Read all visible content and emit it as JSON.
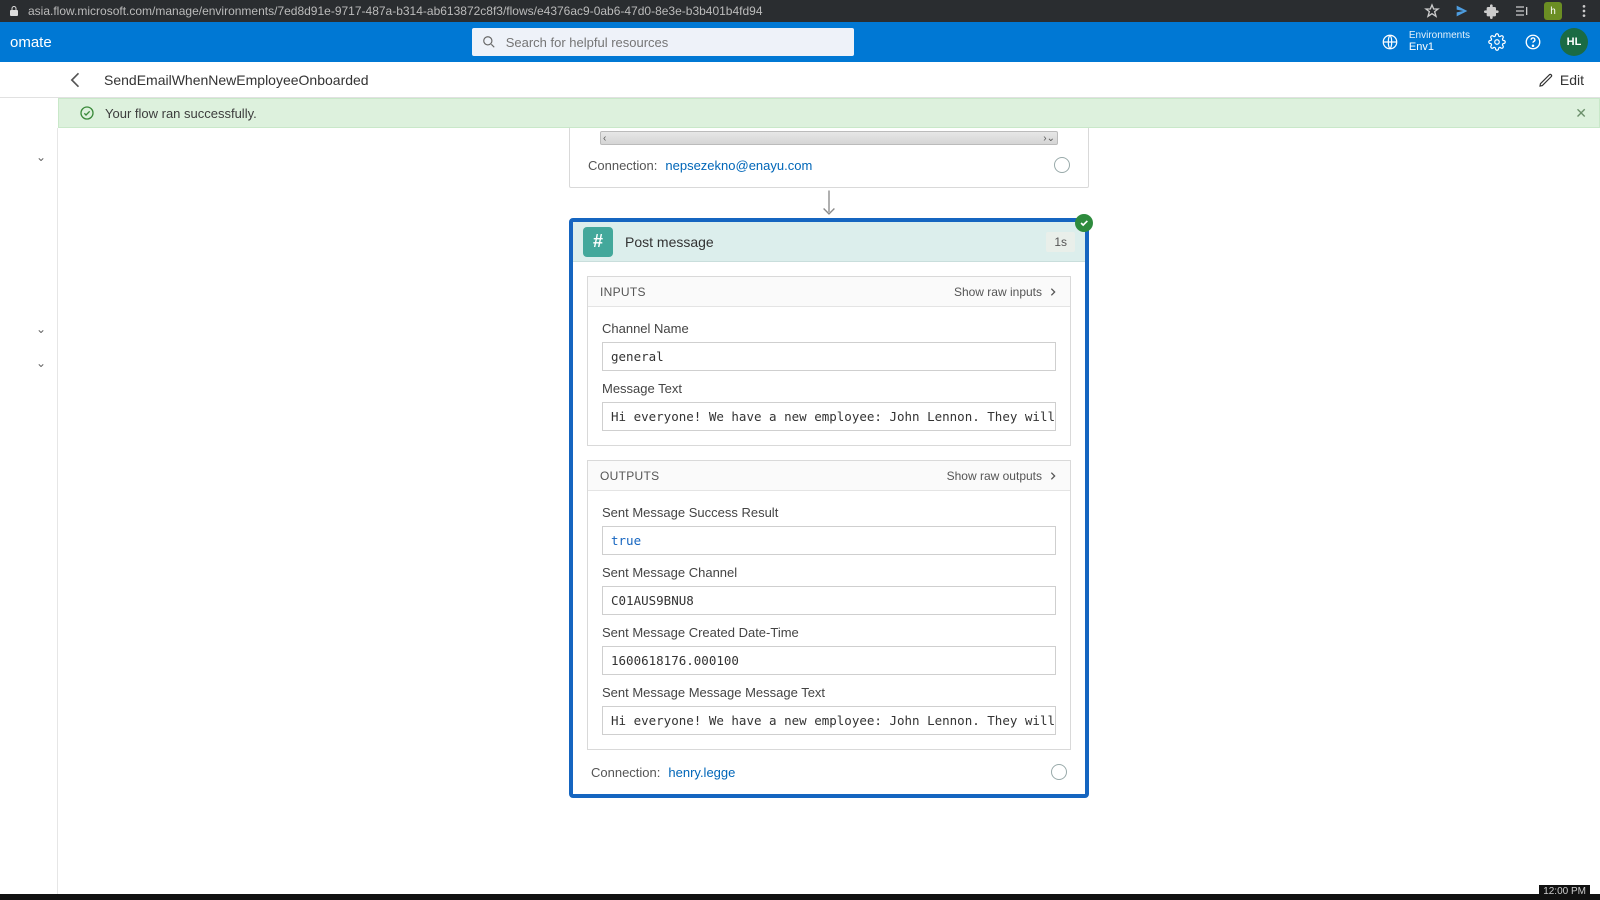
{
  "browser": {
    "url": "asia.flow.microsoft.com/manage/environments/7ed8d91e-9717-487a-b314-ab613872c8f3/flows/e4376ac9-0ab6-47d0-8e3e-b3b401b4fd94",
    "ext_badge": "h"
  },
  "header": {
    "brand": "omate",
    "search_placeholder": "Search for helpful resources",
    "env_label": "Environments",
    "env_name": "Env1",
    "avatar": "HL"
  },
  "crumb": {
    "title": "SendEmailWhenNewEmployeeOnboarded",
    "edit": "Edit"
  },
  "banner": {
    "text": "Your flow ran successfully."
  },
  "prev_step": {
    "connection_label": "Connection:",
    "connection_value": "nepsezekno@enayu.com"
  },
  "step": {
    "title": "Post message",
    "duration": "1s",
    "inputs_label": "INPUTS",
    "show_raw_inputs": "Show raw inputs",
    "outputs_label": "OUTPUTS",
    "show_raw_outputs": "Show raw outputs",
    "inputs": {
      "channel_name_label": "Channel Name",
      "channel_name": "general",
      "message_text_label": "Message Text",
      "message_text": "Hi everyone! We have a new employee: John Lennon. They will be repo"
    },
    "outputs": {
      "success_label": "Sent Message Success Result",
      "success": "true",
      "channel_label": "Sent Message Channel",
      "channel": "C01AUS9BNU8",
      "created_label": "Sent Message Created Date-Time",
      "created": "1600618176.000100",
      "msg_label": "Sent Message Message Message Text",
      "msg": "Hi everyone! We have a new employee: John Lennon. They will be repo"
    },
    "connection_label": "Connection:",
    "connection_value": "henry.legge"
  },
  "clock": "12:00 PM"
}
